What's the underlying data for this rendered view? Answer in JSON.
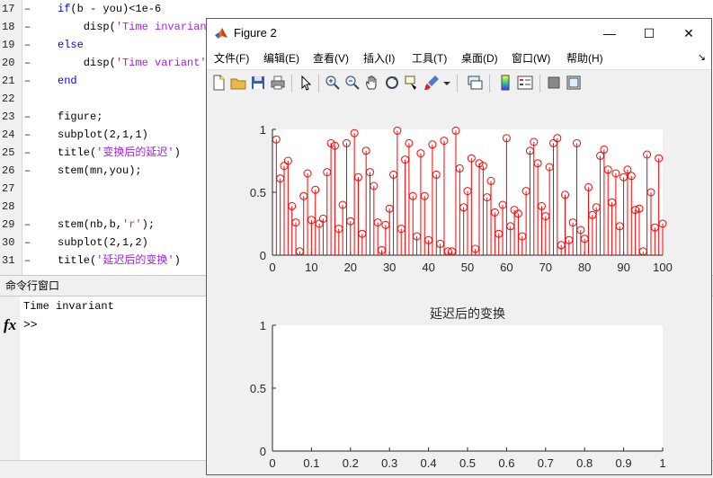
{
  "editor": {
    "lines": [
      {
        "num": "17",
        "dash": "–",
        "parts": [
          {
            "t": "if",
            "c": "kw"
          },
          {
            "t": "(b - you)<1e-6",
            "c": ""
          }
        ]
      },
      {
        "num": "18",
        "dash": "–",
        "parts": [
          {
            "t": "    disp(",
            "c": ""
          },
          {
            "t": "'Time invariant",
            "c": "str"
          }
        ]
      },
      {
        "num": "19",
        "dash": "–",
        "parts": [
          {
            "t": "else",
            "c": "kw"
          }
        ]
      },
      {
        "num": "20",
        "dash": "–",
        "parts": [
          {
            "t": "    disp(",
            "c": ""
          },
          {
            "t": "'Time variant'",
            "c": "str"
          },
          {
            "t": ")",
            "c": ""
          }
        ]
      },
      {
        "num": "21",
        "dash": "–",
        "parts": [
          {
            "t": "end",
            "c": "kw"
          }
        ]
      },
      {
        "num": "22",
        "dash": "",
        "parts": []
      },
      {
        "num": "23",
        "dash": "–",
        "parts": [
          {
            "t": "figure;",
            "c": ""
          }
        ]
      },
      {
        "num": "24",
        "dash": "–",
        "parts": [
          {
            "t": "subplot(2,1,1)",
            "c": ""
          }
        ]
      },
      {
        "num": "25",
        "dash": "–",
        "parts": [
          {
            "t": "title(",
            "c": ""
          },
          {
            "t": "'变换后的延迟'",
            "c": "str"
          },
          {
            "t": ")",
            "c": ""
          }
        ]
      },
      {
        "num": "26",
        "dash": "–",
        "parts": [
          {
            "t": "stem(mn,you);",
            "c": ""
          }
        ]
      },
      {
        "num": "27",
        "dash": "",
        "parts": []
      },
      {
        "num": "28",
        "dash": "",
        "parts": []
      },
      {
        "num": "29",
        "dash": "–",
        "parts": [
          {
            "t": "stem(nb,b,",
            "c": ""
          },
          {
            "t": "'r'",
            "c": "str"
          },
          {
            "t": ");",
            "c": ""
          }
        ]
      },
      {
        "num": "30",
        "dash": "–",
        "parts": [
          {
            "t": "subplot(2,1,2)",
            "c": ""
          }
        ]
      },
      {
        "num": "31",
        "dash": "–",
        "parts": [
          {
            "t": "title(",
            "c": ""
          },
          {
            "t": "'延迟后的变换'",
            "c": "str"
          },
          {
            "t": ")",
            "c": ""
          }
        ]
      }
    ]
  },
  "command_window": {
    "title": "命令行窗口",
    "output": "Time invariant",
    "fx": "fx",
    "prompt": ">>"
  },
  "figure_window": {
    "title": "Figure 2",
    "controls": {
      "minimize": "—",
      "maximize": "☐",
      "close": "✕"
    },
    "menu": [
      "文件(F)",
      "编辑(E)",
      "查看(V)",
      "插入(I)",
      "工具(T)",
      "桌面(D)",
      "窗口(W)",
      "帮助(H)"
    ],
    "menu_more": "↘",
    "toolbar_icons": [
      "new-figure-icon",
      "open-file-icon",
      "save-icon",
      "print-icon",
      "pointer-icon",
      "zoom-in-icon",
      "zoom-out-icon",
      "pan-icon",
      "rotate-icon",
      "data-cursor-icon",
      "brush-icon",
      "dropdown-arrow-icon",
      "link-plot-icon",
      "colorbar-icon",
      "legend-icon",
      "hide-tools-icon",
      "show-tools-icon"
    ]
  },
  "colors": {
    "stem": "#ff0000",
    "keyword": "#0000ff",
    "string": "#a020f0"
  },
  "chart_data": [
    {
      "type": "stem",
      "title": "",
      "xlim": [
        0,
        100
      ],
      "ylim": [
        0,
        1
      ],
      "xticks": [
        "0",
        "10",
        "20",
        "30",
        "40",
        "50",
        "60",
        "70",
        "80",
        "90",
        "100"
      ],
      "yticks": [
        "0",
        "0.5",
        "1"
      ],
      "x": [
        1,
        2,
        3,
        4,
        5,
        6,
        7,
        8,
        9,
        10,
        11,
        12,
        13,
        14,
        15,
        16,
        17,
        18,
        19,
        20,
        21,
        22,
        23,
        24,
        25,
        26,
        27,
        28,
        29,
        30,
        31,
        32,
        33,
        34,
        35,
        36,
        37,
        38,
        39,
        40,
        41,
        42,
        43,
        44,
        45,
        46,
        47,
        48,
        49,
        50,
        51,
        52,
        53,
        54,
        55,
        56,
        57,
        58,
        59,
        60,
        61,
        62,
        63,
        64,
        65,
        66,
        67,
        68,
        69,
        70,
        71,
        72,
        73,
        74,
        75,
        76,
        77,
        78,
        79,
        80,
        81,
        82,
        83,
        84,
        85,
        86,
        87,
        88,
        89,
        90,
        91,
        92,
        93,
        94,
        95,
        96,
        97,
        98,
        99,
        100
      ],
      "values": [
        0.92,
        0.61,
        0.71,
        0.75,
        0.39,
        0.26,
        0.03,
        0.47,
        0.65,
        0.28,
        0.52,
        0.25,
        0.29,
        0.66,
        0.89,
        0.87,
        0.21,
        0.4,
        0.89,
        0.27,
        0.97,
        0.62,
        0.17,
        0.83,
        0.66,
        0.55,
        0.26,
        0.04,
        0.24,
        0.37,
        0.64,
        0.99,
        0.21,
        0.76,
        0.89,
        0.47,
        0.15,
        0.81,
        0.47,
        0.12,
        0.88,
        0.64,
        0.09,
        0.91,
        0.03,
        0.03,
        0.99,
        0.69,
        0.38,
        0.51,
        0.77,
        0.05,
        0.73,
        0.71,
        0.46,
        0.59,
        0.34,
        0.17,
        0.4,
        0.93,
        0.23,
        0.36,
        0.33,
        0.15,
        0.51,
        0.83,
        0.9,
        0.73,
        0.39,
        0.31,
        0.7,
        0.89,
        0.93,
        0.08,
        0.48,
        0.12,
        0.26,
        0.89,
        0.2,
        0.13,
        0.54,
        0.32,
        0.38,
        0.79,
        0.84,
        0.68,
        0.42,
        0.65,
        0.23,
        0.62,
        0.68,
        0.63,
        0.36,
        0.37,
        0.03,
        0.8,
        0.5,
        0.22,
        0.77,
        0.25
      ]
    },
    {
      "type": "line",
      "title": "延迟后的变换",
      "xlim": [
        0,
        1
      ],
      "ylim": [
        0,
        1
      ],
      "xticks": [
        "0",
        "0.1",
        "0.2",
        "0.3",
        "0.4",
        "0.5",
        "0.6",
        "0.7",
        "0.8",
        "0.9",
        "1"
      ],
      "yticks": [
        "0",
        "0.5",
        "1"
      ],
      "values": []
    }
  ]
}
